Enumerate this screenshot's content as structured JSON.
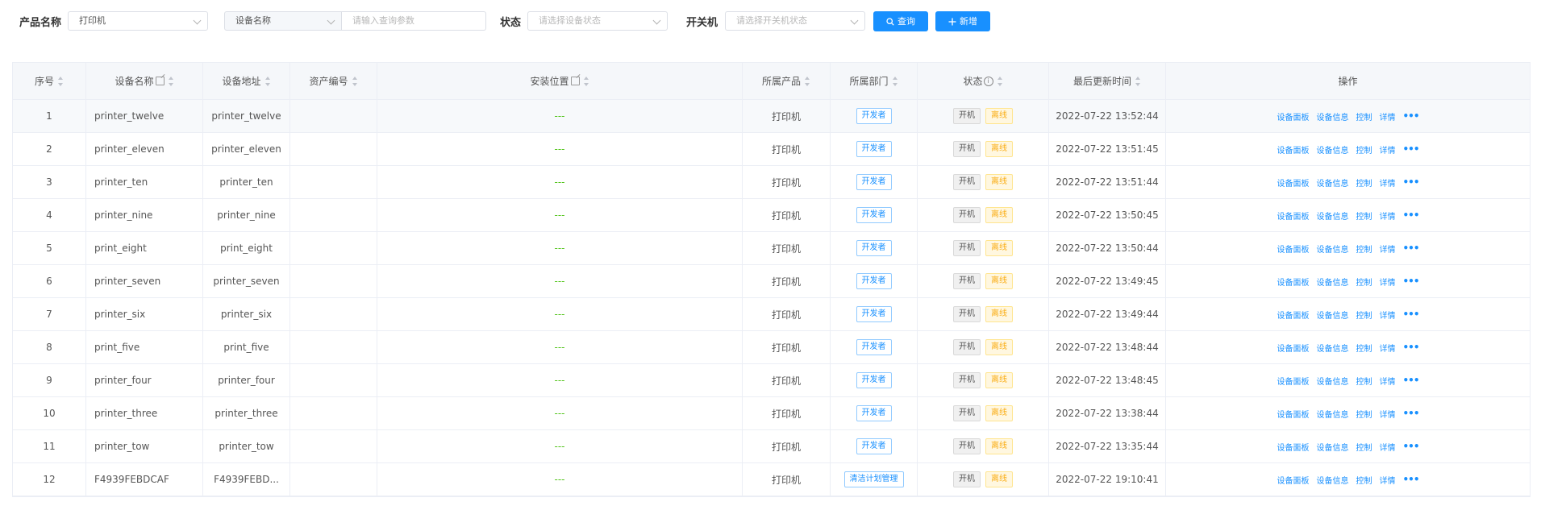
{
  "filters": {
    "product_label": "产品名称",
    "product_value": "打印机",
    "field_select_value": "设备名称",
    "query_placeholder": "请输入查询参数",
    "status_label": "状态",
    "status_placeholder": "请选择设备状态",
    "power_label": "开关机",
    "power_placeholder": "请选择开关机状态",
    "query_button": "查询",
    "add_button": "新增"
  },
  "table": {
    "headers": [
      "序号",
      "设备名称",
      "设备地址",
      "资产编号",
      "安装位置",
      "所属产品",
      "所属部门",
      "状态",
      "最后更新时间",
      "操作"
    ],
    "actions": [
      "设备面板",
      "设备信息",
      "控制",
      "详情"
    ],
    "more_glyph": "•••",
    "info_glyph": "i",
    "rows": [
      {
        "idx": "1",
        "name": "printer_twelve",
        "addr": "printer_twelve",
        "asset": "",
        "loc": "---",
        "product": "打印机",
        "dept": "开发者",
        "power": "开机",
        "status": "离线",
        "time": "2022-07-22 13:52:44"
      },
      {
        "idx": "2",
        "name": "printer_eleven",
        "addr": "printer_eleven",
        "asset": "",
        "loc": "---",
        "product": "打印机",
        "dept": "开发者",
        "power": "开机",
        "status": "离线",
        "time": "2022-07-22 13:51:45"
      },
      {
        "idx": "3",
        "name": "printer_ten",
        "addr": "printer_ten",
        "asset": "",
        "loc": "---",
        "product": "打印机",
        "dept": "开发者",
        "power": "开机",
        "status": "离线",
        "time": "2022-07-22 13:51:44"
      },
      {
        "idx": "4",
        "name": "printer_nine",
        "addr": "printer_nine",
        "asset": "",
        "loc": "---",
        "product": "打印机",
        "dept": "开发者",
        "power": "开机",
        "status": "离线",
        "time": "2022-07-22 13:50:45"
      },
      {
        "idx": "5",
        "name": "print_eight",
        "addr": "print_eight",
        "asset": "",
        "loc": "---",
        "product": "打印机",
        "dept": "开发者",
        "power": "开机",
        "status": "离线",
        "time": "2022-07-22 13:50:44"
      },
      {
        "idx": "6",
        "name": "printer_seven",
        "addr": "printer_seven",
        "asset": "",
        "loc": "---",
        "product": "打印机",
        "dept": "开发者",
        "power": "开机",
        "status": "离线",
        "time": "2022-07-22 13:49:45"
      },
      {
        "idx": "7",
        "name": "printer_six",
        "addr": "printer_six",
        "asset": "",
        "loc": "---",
        "product": "打印机",
        "dept": "开发者",
        "power": "开机",
        "status": "离线",
        "time": "2022-07-22 13:49:44"
      },
      {
        "idx": "8",
        "name": "print_five",
        "addr": "print_five",
        "asset": "",
        "loc": "---",
        "product": "打印机",
        "dept": "开发者",
        "power": "开机",
        "status": "离线",
        "time": "2022-07-22 13:48:44"
      },
      {
        "idx": "9",
        "name": "printer_four",
        "addr": "printer_four",
        "asset": "",
        "loc": "---",
        "product": "打印机",
        "dept": "开发者",
        "power": "开机",
        "status": "离线",
        "time": "2022-07-22 13:48:45"
      },
      {
        "idx": "10",
        "name": "printer_three",
        "addr": "printer_three",
        "asset": "",
        "loc": "---",
        "product": "打印机",
        "dept": "开发者",
        "power": "开机",
        "status": "离线",
        "time": "2022-07-22 13:38:44"
      },
      {
        "idx": "11",
        "name": "printer_tow",
        "addr": "printer_tow",
        "asset": "",
        "loc": "---",
        "product": "打印机",
        "dept": "开发者",
        "power": "开机",
        "status": "离线",
        "time": "2022-07-22 13:35:44"
      },
      {
        "idx": "12",
        "name": "F4939FEBDCAF",
        "addr": "F4939FEBD...",
        "asset": "",
        "loc": "---",
        "product": "打印机",
        "dept": "清洁计划管理",
        "power": "开机",
        "status": "离线",
        "time": "2022-07-22 19:10:41"
      }
    ]
  },
  "colors": {
    "primary": "#1890ff",
    "offline": "#faad14",
    "placeholder_dash": "#52c41a"
  }
}
